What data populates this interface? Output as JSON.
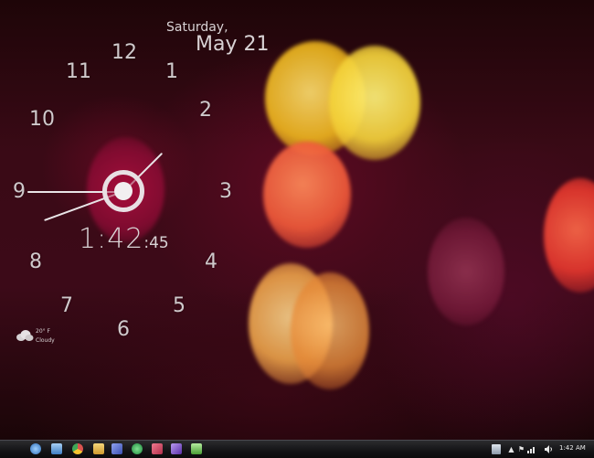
{
  "date_widget": {
    "weekday": "Saturday,",
    "month_day": "May 21"
  },
  "clock": {
    "numerals": [
      "12",
      "1",
      "2",
      "3",
      "4",
      "5",
      "6",
      "7",
      "8",
      "9",
      "10",
      "11"
    ],
    "digital_hm": "1:42",
    "digital_sec": ":45"
  },
  "weather": {
    "temperature": "20° F",
    "condition": "Cloudy",
    "icon": "cloud-icon"
  },
  "taskbar": {
    "pinned_apps": [
      {
        "icon": "start-orb-icon",
        "color": "#4d8fd6"
      },
      {
        "icon": "computer-icon",
        "color": "#5aa0e0"
      },
      {
        "icon": "chrome-icon",
        "color": "#d9534f"
      },
      {
        "icon": "folder-icon",
        "color": "#e0b84a"
      },
      {
        "icon": "feather-icon",
        "color": "#6c7fd8"
      },
      {
        "icon": "vlc-icon",
        "color": "#2e9e4f"
      },
      {
        "icon": "media-icon",
        "color": "#d64a6a"
      },
      {
        "icon": "shield-icon",
        "color": "#8a5fd0"
      },
      {
        "icon": "notepad-icon",
        "color": "#6bbf5a"
      }
    ],
    "tray_icons": [
      "recycle-icon",
      "chevron-up-icon",
      "flag-icon",
      "network-icon",
      "volume-icon"
    ],
    "time": "1:42 AM"
  }
}
